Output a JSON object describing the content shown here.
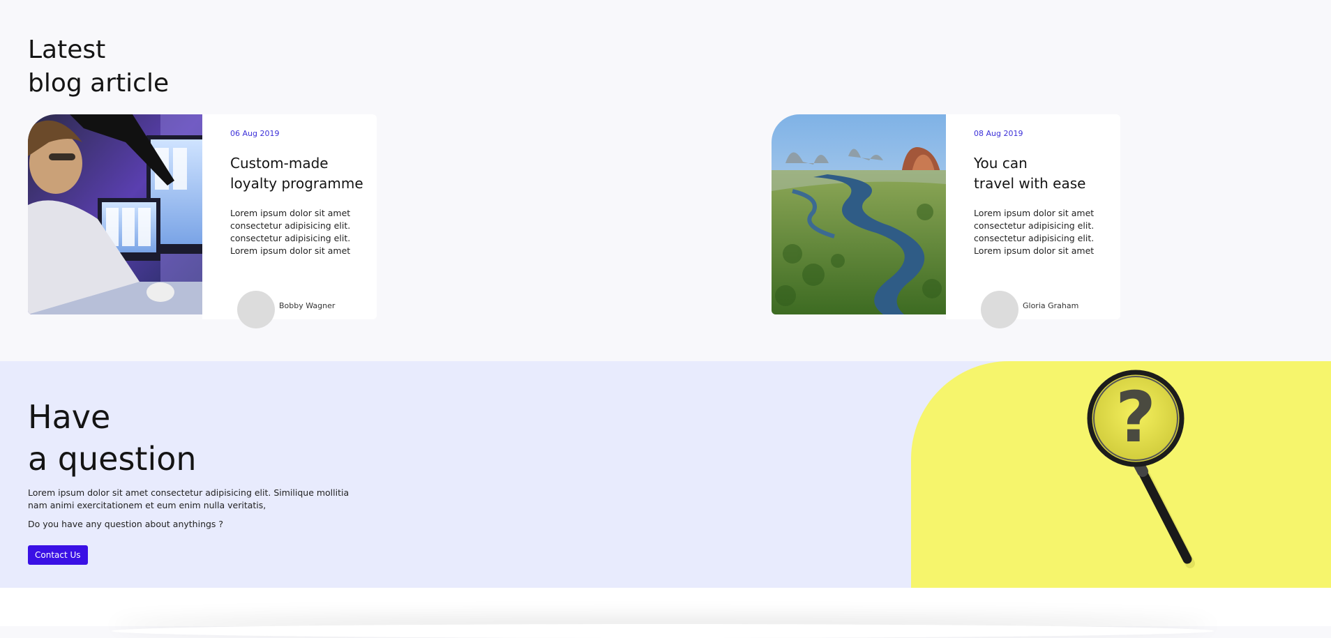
{
  "blog": {
    "heading_line1": "Latest",
    "heading_line2": "blog article",
    "articles": [
      {
        "date": "06 Aug 2019",
        "title_line1": "Custom-made",
        "title_line2": "loyalty programme",
        "excerpt": [
          "Lorem ipsum dolor sit amet",
          "consectetur adipisicing elit.",
          "consectetur adipisicing elit.",
          "Lorem ipsum dolor sit amet"
        ],
        "author": "Bobby Wagner",
        "image": "woman-at-computer-photo"
      },
      {
        "date": "08 Aug 2019",
        "title_line1": "You can",
        "title_line2": "travel with ease",
        "excerpt": [
          "Lorem ipsum dolor sit amet",
          "consectetur adipisicing elit.",
          "consectetur adipisicing elit.",
          "Lorem ipsum dolor sit amet"
        ],
        "author": "Gloria Graham",
        "image": "river-landscape-photo"
      }
    ]
  },
  "question": {
    "heading_line1": "Have",
    "heading_line2": "a question",
    "text_line1": "Lorem ipsum dolor sit amet consectetur adipisicing elit. Similique mollitia",
    "text_line2": "nam animi exercitationem et eum enim nulla veritatis,",
    "prompt": "Do you have any question about anythings ?",
    "button_label": "Contact Us",
    "image": "magnifying-glass-question-photo"
  },
  "colors": {
    "accent": "#3a10e5",
    "date": "#3b2fd8",
    "question_bg": "#e8ebfd",
    "question_image_bg": "#f6f56c",
    "page_bg": "#f8f8fb"
  }
}
